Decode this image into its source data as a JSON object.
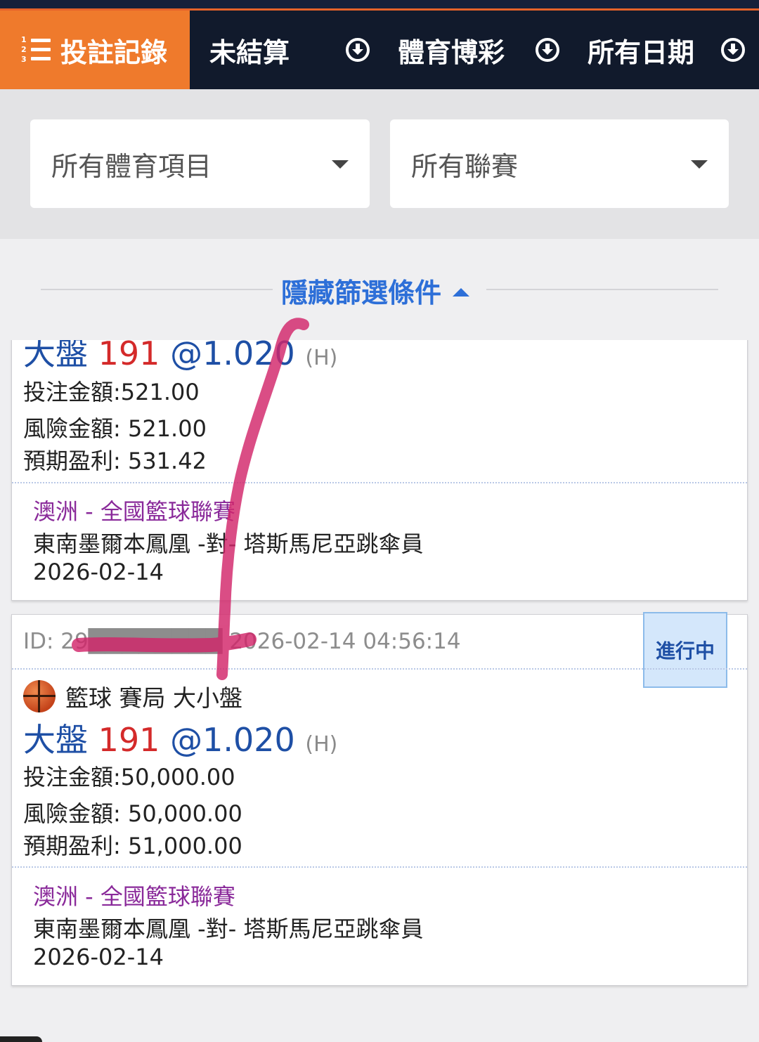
{
  "nav": {
    "active_label": "投註記錄",
    "list_numbers": [
      "1",
      "2",
      "3"
    ],
    "items": [
      {
        "label": "未結算"
      },
      {
        "label": "體育博彩"
      },
      {
        "label": "所有日期"
      }
    ]
  },
  "filters": {
    "sport_select": "所有體育項目",
    "league_select": "所有聯賽",
    "toggle_label": "隱藏篩選條件"
  },
  "bets": [
    {
      "selection": "大盤",
      "line": "191",
      "odds": "@1.020",
      "half": "(H)",
      "stake": "投注金額:521.00",
      "risk": "風險金額: 521.00",
      "profit": "預期盈利: 531.42",
      "league": "澳洲 - 全國籃球聯賽",
      "match": "東南墨爾本鳳凰 -對- 塔斯馬尼亞跳傘員",
      "date": "2026-02-14"
    },
    {
      "id_line": "ID: 29████████ 2026-02-14 04:56:14",
      "status": "進行中",
      "sport": "籃球 賽局 大小盤",
      "selection": "大盤",
      "line": "191",
      "odds": "@1.020",
      "half": "(H)",
      "stake": "投注金額:50,000.00",
      "risk": "風險金額: 50,000.00",
      "profit": "預期盈利: 51,000.00",
      "league": "澳洲 - 全國籃球聯賽",
      "match": "東南墨爾本鳳凰 -對- 塔斯馬尼亞跳傘員",
      "date": "2026-02-14"
    }
  ],
  "colors": {
    "nav_bg": "#111a2c",
    "active_tab": "#ef7a2c",
    "accent_blue": "#2d6fd8",
    "league_purple": "#8a2a9a",
    "line_red": "#d42a2a",
    "ink": "#d2266a"
  }
}
